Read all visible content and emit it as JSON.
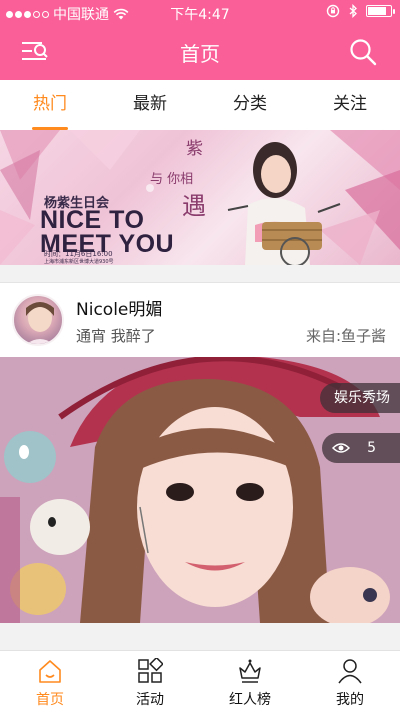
{
  "status_bar": {
    "carrier": "中国联通",
    "time": "下午4:47",
    "signal_bars_filled": 3,
    "signal_bars_total": 5,
    "battery_level": 0.85
  },
  "header": {
    "title": "首页",
    "menu_icon": "menu-search-list-icon",
    "search_icon": "search-icon",
    "background_color": "#fa5f97"
  },
  "tabs": [
    {
      "label": "热门",
      "active": true
    },
    {
      "label": "最新",
      "active": false
    },
    {
      "label": "分类",
      "active": false
    },
    {
      "label": "关注",
      "active": false
    }
  ],
  "accent_color": "#ff8a1e",
  "banner": {
    "subtitle": "杨紫生日会",
    "title_line1": "NICE TO",
    "title_line2": "MEET YOU",
    "time_text": "时间：11月6日16:00",
    "address_text": "上海市浦东新区世博大道930号",
    "poem_1": "紫",
    "poem_2": "与 你相",
    "poem_3": "遇"
  },
  "post": {
    "author": "Nicole明媚",
    "text": "通宵 我醉了",
    "source": "来自:鱼子酱",
    "channel_badge": "娱乐秀场",
    "view_count": "5"
  },
  "bottom_nav": [
    {
      "label": "首页",
      "icon": "home-icon",
      "active": true
    },
    {
      "label": "活动",
      "icon": "grid-activity-icon",
      "active": false
    },
    {
      "label": "红人榜",
      "icon": "crown-ranking-icon",
      "active": false
    },
    {
      "label": "我的",
      "icon": "user-profile-icon",
      "active": false
    }
  ]
}
